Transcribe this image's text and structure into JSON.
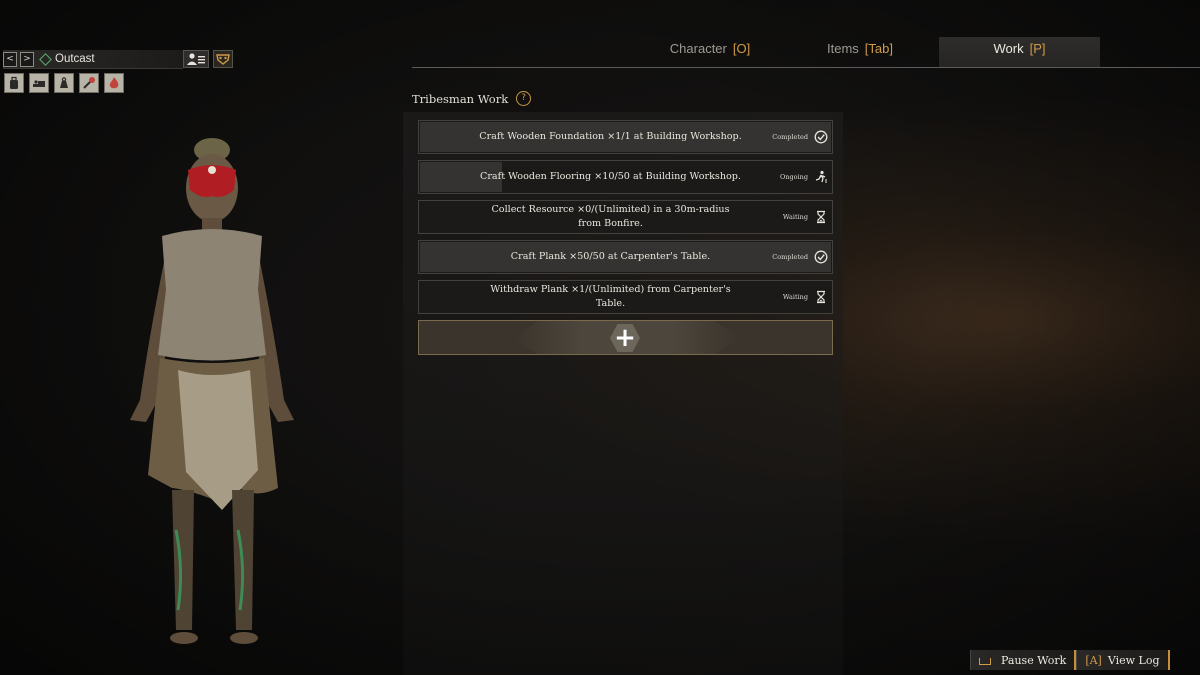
{
  "character": {
    "name": "Outcast",
    "prev_glyph": "<",
    "next_glyph": ">",
    "status_icons": [
      "backpack-icon",
      "bed-rest-icon",
      "weight-icon",
      "tool-icon",
      "fire-icon"
    ]
  },
  "tabs": [
    {
      "label": "Character",
      "key": "[O]",
      "active": false
    },
    {
      "label": "Items",
      "key": "[Tab]",
      "active": false
    },
    {
      "label": "Work",
      "key": "[P]",
      "active": true
    }
  ],
  "section": {
    "title": "Tribesman Work",
    "help_glyph": "?"
  },
  "tasks": [
    {
      "text": "Craft Wooden Foundation ×1/1 at Building Workshop.",
      "status": "Completed",
      "status_icon": "check-circle-icon",
      "progress": 1.0
    },
    {
      "text": "Craft Wooden Flooring ×10/50 at Building Workshop.",
      "status": "Ongoing",
      "status_icon": "running-icon",
      "progress": 0.2
    },
    {
      "text": "Collect Resource ×0/(Unlimited) in a 30m-radius from Bonfire.",
      "status": "Waiting",
      "status_icon": "hourglass-icon",
      "progress": 0.0
    },
    {
      "text": "Craft Plank ×50/50 at Carpenter's Table.",
      "status": "Completed",
      "status_icon": "check-circle-icon",
      "progress": 1.0
    },
    {
      "text": "Withdraw Plank ×1/(Unlimited) from Carpenter's Table.",
      "status": "Waiting",
      "status_icon": "hourglass-icon",
      "progress": 0.0
    }
  ],
  "add_button": {
    "glyph": "+"
  },
  "bottom": {
    "pause": {
      "label": "Pause Work"
    },
    "log": {
      "key": "[A]",
      "label": "View Log"
    }
  }
}
